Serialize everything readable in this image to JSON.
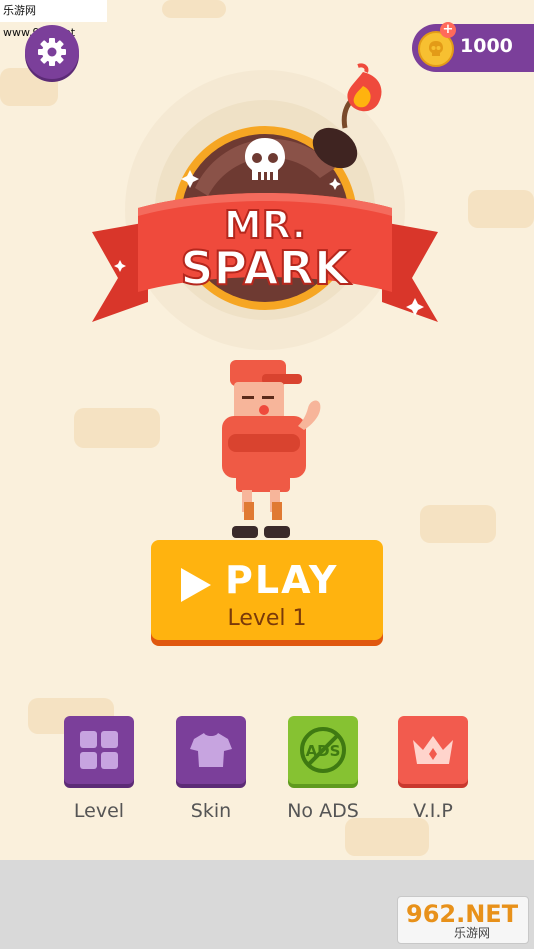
{
  "watermark": {
    "top_text": "乐游网 www.962.net",
    "logo_main": "962.NET",
    "logo_sub": "乐游网"
  },
  "title": {
    "line1": "MR.",
    "line2": "SPARK"
  },
  "currency": {
    "amount": "1000",
    "plus": "+"
  },
  "play": {
    "label": "PLAY",
    "level": "Level 1"
  },
  "menu": [
    {
      "label": "Level",
      "icon": "grid-icon",
      "color": "#7b3f9a"
    },
    {
      "label": "Skin",
      "icon": "shirt-icon",
      "color": "#7b3f9a"
    },
    {
      "label": "No ADS",
      "icon": "no-ads-icon",
      "badge_text": "ADS",
      "color": "#86c232"
    },
    {
      "label": "V.I.P",
      "icon": "crown-icon",
      "color": "#f25b4e"
    }
  ],
  "colors": {
    "accent_purple": "#7b3f9a",
    "play_orange": "#ffb30f",
    "ribbon_red": "#ef4a3c",
    "background": "#faf0dc"
  }
}
